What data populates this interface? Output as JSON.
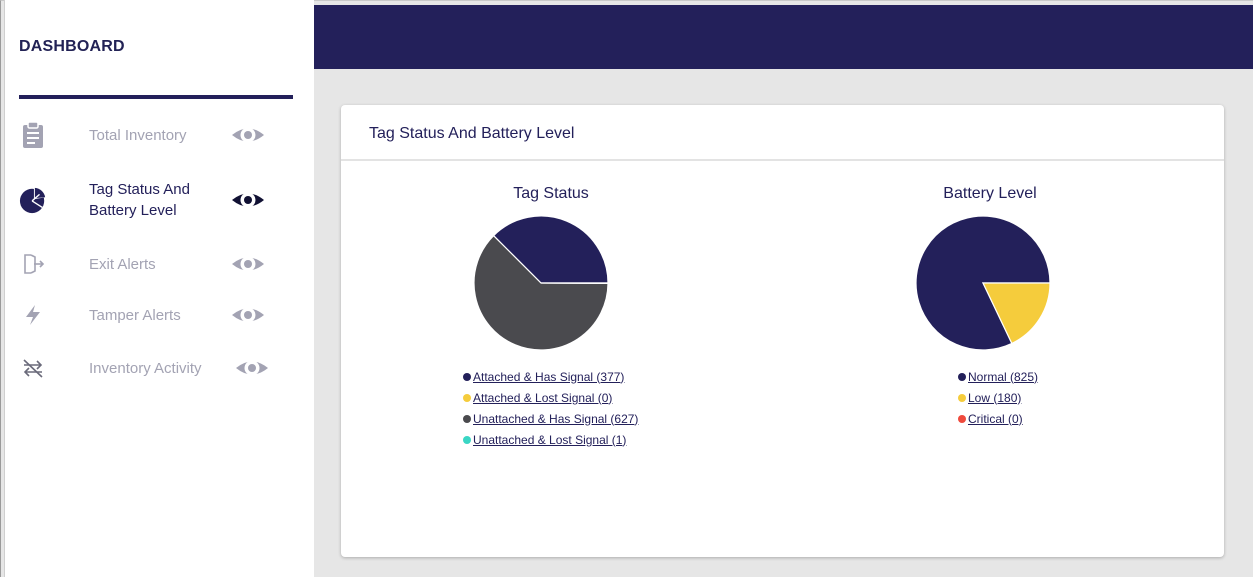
{
  "sidebar": {
    "title": "DASHBOARD",
    "items": [
      {
        "label": "Total Inventory",
        "icon": "clipboard-icon",
        "active": false
      },
      {
        "label": "Tag Status And Battery Level",
        "icon": "pie-chart-icon",
        "active": true
      },
      {
        "label": "Exit Alerts",
        "icon": "exit-icon",
        "active": false
      },
      {
        "label": "Tamper Alerts",
        "icon": "lightning-icon",
        "active": false
      },
      {
        "label": "Inventory Activity",
        "icon": "transfer-off-icon",
        "active": false
      }
    ]
  },
  "card": {
    "title": "Tag Status And Battery Level"
  },
  "colors": {
    "navy": "#23205a",
    "yellow": "#f5cc3c",
    "gray": "#4a4a4e",
    "teal": "#3ad6c4",
    "red": "#ef4a3c",
    "muted": "#a3a3b3"
  },
  "chart_data": [
    {
      "type": "pie",
      "title": "Tag Status",
      "series": [
        {
          "name": "Attached & Has Signal",
          "value": 377,
          "color": "#23205a",
          "legend": "Attached & Has Signal (377)"
        },
        {
          "name": "Attached & Lost Signal",
          "value": 0,
          "color": "#f5cc3c",
          "legend": "Attached & Lost Signal (0)"
        },
        {
          "name": "Unattached & Has Signal",
          "value": 627,
          "color": "#4a4a4e",
          "legend": "Unattached & Has Signal (627)"
        },
        {
          "name": "Unattached & Lost Signal",
          "value": 1,
          "color": "#3ad6c4",
          "legend": "Unattached & Lost Signal (1)"
        }
      ]
    },
    {
      "type": "pie",
      "title": "Battery Level",
      "series": [
        {
          "name": "Normal",
          "value": 825,
          "color": "#23205a",
          "legend": "Normal (825)"
        },
        {
          "name": "Low",
          "value": 180,
          "color": "#f5cc3c",
          "legend": "Low (180)"
        },
        {
          "name": "Critical",
          "value": 0,
          "color": "#ef4a3c",
          "legend": "Critical (0)"
        }
      ]
    }
  ]
}
